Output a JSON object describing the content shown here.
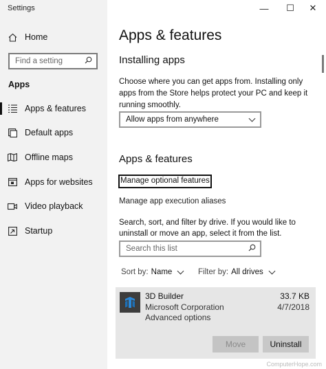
{
  "window": {
    "title": "Settings",
    "minimize_glyph": "—",
    "maximize_glyph": "☐",
    "close_glyph": "✕"
  },
  "sidebar": {
    "home_label": "Home",
    "search_placeholder": "Find a setting",
    "section_label": "Apps",
    "items": [
      {
        "label": "Apps & features",
        "icon": "list-icon",
        "active": true
      },
      {
        "label": "Default apps",
        "icon": "default-apps-icon",
        "active": false
      },
      {
        "label": "Offline maps",
        "icon": "map-icon",
        "active": false
      },
      {
        "label": "Apps for websites",
        "icon": "websites-icon",
        "active": false
      },
      {
        "label": "Video playback",
        "icon": "video-icon",
        "active": false
      },
      {
        "label": "Startup",
        "icon": "startup-icon",
        "active": false
      }
    ]
  },
  "main": {
    "page_title": "Apps & features",
    "installing_heading": "Installing apps",
    "installing_desc": "Choose where you can get apps from. Installing only apps from the Store helps protect your PC and keep it running smoothly.",
    "install_source_selected": "Allow apps from anywhere",
    "features_heading": "Apps & features",
    "optional_features_link": "Manage optional features",
    "execution_aliases_link": "Manage app execution aliases",
    "list_desc": "Search, sort, and filter by drive. If you would like to uninstall or move an app, select it from the list.",
    "list_search_placeholder": "Search this list",
    "sort_label": "Sort by:",
    "sort_value": "Name",
    "filter_label": "Filter by:",
    "filter_value": "All drives",
    "apps": [
      {
        "name": "3D Builder",
        "publisher": "Microsoft Corporation",
        "advanced": "Advanced options",
        "size": "33.7 KB",
        "date": "4/7/2018",
        "move_label": "Move",
        "uninstall_label": "Uninstall"
      }
    ]
  },
  "watermark": "ComputerHope.com",
  "colors": {
    "sidebar_bg": "#f2f2f2",
    "card_bg": "#e6e6e6",
    "app_icon_bg": "#3d3d3d",
    "accent": "#2b88d8"
  }
}
